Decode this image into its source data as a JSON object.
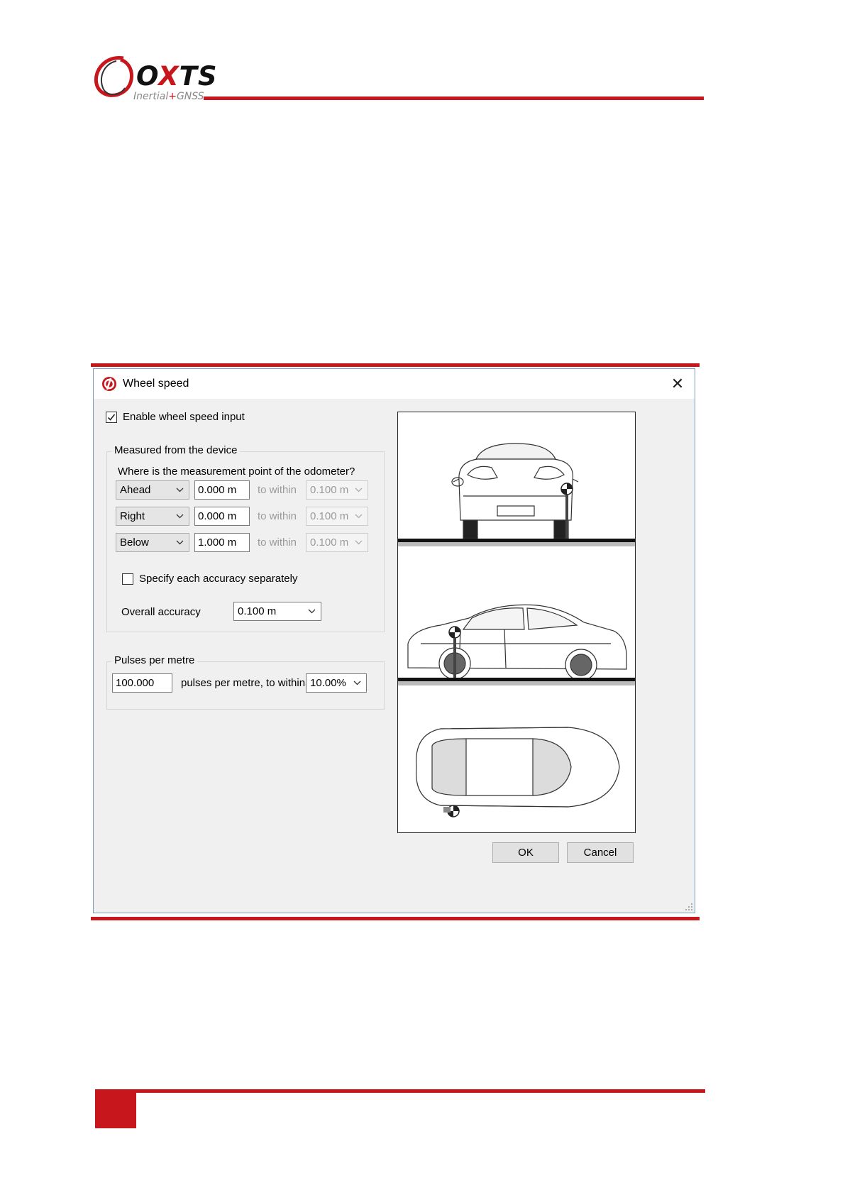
{
  "brand": {
    "name_prefix": "O",
    "name_x": "X",
    "name_suffix": "TS",
    "tagline_a": "Inertial",
    "tagline_plus": "+",
    "tagline_b": "GNSS"
  },
  "dialog": {
    "title": "Wheel speed",
    "close_glyph": "✕",
    "enable_label": "Enable wheel speed input",
    "enable_checked": true,
    "measured_group": {
      "legend": "Measured from the device",
      "question": "Where is the measurement point of the odometer?",
      "rows": [
        {
          "direction": "Ahead",
          "distance": "0.000 m",
          "to_within": "to within",
          "accuracy": "0.100 m"
        },
        {
          "direction": "Right",
          "distance": "0.000 m",
          "to_within": "to within",
          "accuracy": "0.100 m"
        },
        {
          "direction": "Below",
          "distance": "1.000 m",
          "to_within": "to within",
          "accuracy": "0.100 m"
        }
      ],
      "specify_label": "Specify each accuracy separately",
      "specify_checked": false,
      "overall_label": "Overall accuracy",
      "overall_value": "0.100 m"
    },
    "pulses_group": {
      "legend": "Pulses per metre",
      "value": "100.000",
      "middle_label": "pulses per metre, to within",
      "tolerance": "10.00%"
    },
    "ok_label": "OK",
    "cancel_label": "Cancel"
  },
  "colors": {
    "accent_red": "#c8161d",
    "dialog_bg": "#f0f0f0",
    "dialog_border": "#7a9cc9"
  }
}
